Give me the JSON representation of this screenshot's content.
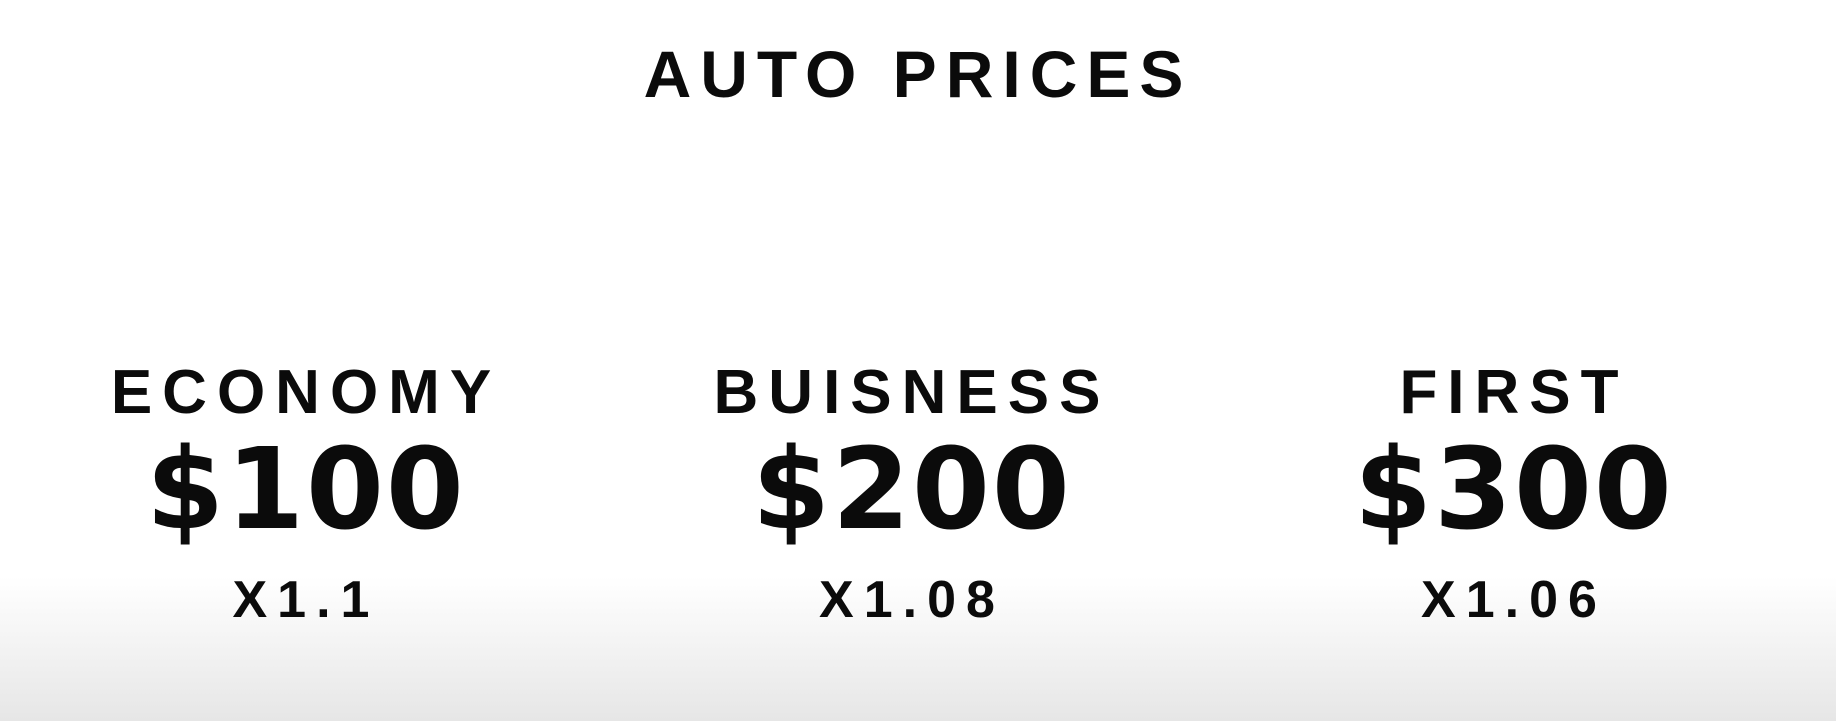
{
  "title": "AUTO PRICES",
  "tiers": [
    {
      "name": "ECONOMY",
      "price": "$100",
      "multiplier": "X1.1"
    },
    {
      "name": "BUISNESS",
      "price": "$200",
      "multiplier": "X1.08"
    },
    {
      "name": "FIRST",
      "price": "$300",
      "multiplier": "X1.06"
    }
  ]
}
